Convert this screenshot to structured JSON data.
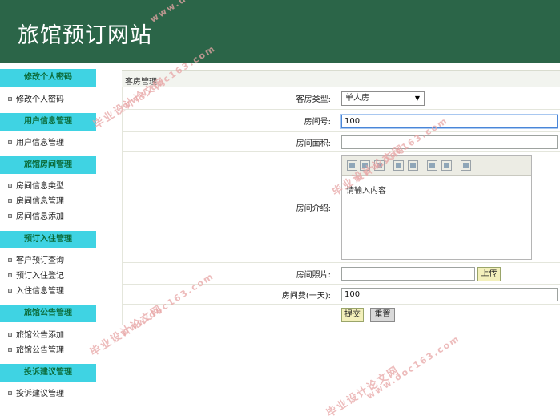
{
  "header": {
    "title": "旅馆预订网站"
  },
  "sidebar": {
    "sections": [
      {
        "title": "修改个人密码",
        "items": [
          "修改个人密码"
        ]
      },
      {
        "title": "用户信息管理",
        "items": [
          "用户信息管理"
        ]
      },
      {
        "title": "旅馆房间管理",
        "items": [
          "房间信息类型",
          "房间信息管理",
          "房间信息添加"
        ]
      },
      {
        "title": "预订入住管理",
        "items": [
          "客户预订查询",
          "预订入住登记",
          "入住信息管理"
        ]
      },
      {
        "title": "旅馆公告管理",
        "items": [
          "旅馆公告添加",
          "旅馆公告管理"
        ]
      },
      {
        "title": "投诉建议管理",
        "items": [
          "投诉建议管理"
        ]
      }
    ]
  },
  "main": {
    "title": "客房管理",
    "form": {
      "room_type_label": "客房类型:",
      "room_type_value": "单人房",
      "room_number_label": "房间号:",
      "room_number_value": "100",
      "room_area_label": "房间面积:",
      "room_area_value": "",
      "intro_label": "房间介绍:",
      "intro_placeholder": "请输入内容",
      "photo_label": "房间照片:",
      "photo_value": "",
      "upload_label": "上传",
      "fee_label": "房间费(一天):",
      "fee_value": "100",
      "submit_label": "提交",
      "reset_label": "重置"
    }
  },
  "watermark": {
    "site": "www.doc163.com",
    "name": "毕业设计论文网"
  }
}
